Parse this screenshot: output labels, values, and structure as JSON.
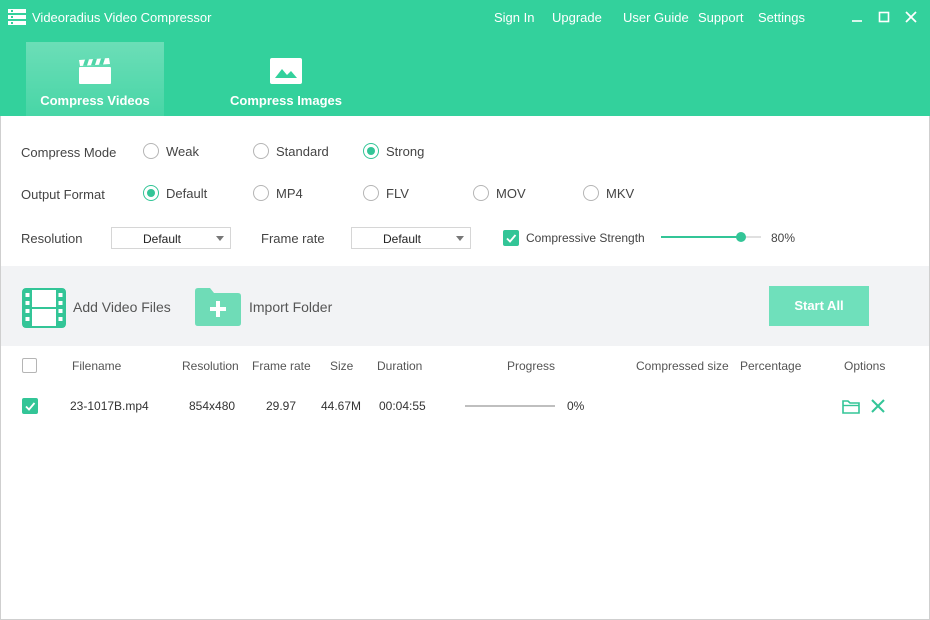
{
  "app": {
    "title": "Videoradius Video Compressor"
  },
  "topnav": [
    "Sign In",
    "Upgrade",
    "User Guide",
    "Support",
    "Settings"
  ],
  "tabs": [
    {
      "label": "Compress Videos",
      "icon": "clapperboard-icon",
      "active": true
    },
    {
      "label": "Compress Images",
      "icon": "image-icon",
      "active": false
    }
  ],
  "settings": {
    "compress_mode": {
      "label": "Compress Mode",
      "options": [
        "Weak",
        "Standard",
        "Strong"
      ],
      "selected": "Strong"
    },
    "output_format": {
      "label": "Output Format",
      "options": [
        "Default",
        "MP4",
        "FLV",
        "MOV",
        "MKV"
      ],
      "selected": "Default"
    },
    "resolution": {
      "label": "Resolution",
      "value": "Default"
    },
    "frame_rate": {
      "label": "Frame rate",
      "value": "Default"
    },
    "strength": {
      "label": "Compressive Strength",
      "checked": true,
      "value": 80,
      "value_text": "80%"
    }
  },
  "toolbar": {
    "add_files": "Add Video Files",
    "import_folder": "Import Folder",
    "start_all": "Start All"
  },
  "table": {
    "columns": [
      "Filename",
      "Resolution",
      "Frame rate",
      "Size",
      "Duration",
      "Progress",
      "Compressed size",
      "Percentage",
      "Options"
    ],
    "rows": [
      {
        "checked": true,
        "filename": "23-1017B.mp4",
        "resolution": "854x480",
        "frame_rate": "29.97",
        "size": "44.67M",
        "duration": "00:04:55",
        "progress": 0,
        "progress_text": "0%",
        "compressed_size": "",
        "percentage": ""
      }
    ]
  },
  "colors": {
    "accent": "#33d19c",
    "button_disabled": "#6fe0bb",
    "toolbar_bg": "#f2f3f5"
  }
}
